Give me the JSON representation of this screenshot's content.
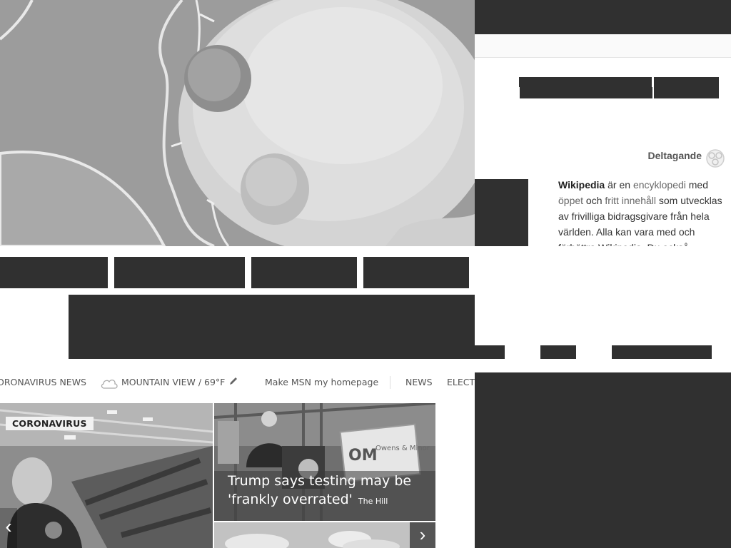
{
  "wiki": {
    "participation_label": "Deltagande",
    "intro": {
      "bold": "Wikipedia",
      "t1": " är en ",
      "link1": "encyklopedi",
      "t2": " med ",
      "link2": "öppet",
      "t3": " och ",
      "link3": "fritt innehåll",
      "t4": " som utvecklas av frivilliga bidragsgivare från hela världen. Alla kan vara med och förbättra Wikipedia. Du också."
    }
  },
  "msn": {
    "coronavirus_news": "ORONAVIRUS NEWS",
    "weather": "MOUNTAIN VIEW / 69°F",
    "homepage_link": "Make MSN my homepage",
    "news_link": "NEWS",
    "elections_link": "ELECTI"
  },
  "cards": {
    "badge": "CORONAVIRUS",
    "headline": "Trump says testing may be 'frankly overrated'",
    "source": "The Hill",
    "sign_text": "Owens & Minor",
    "sign_logo": "OM"
  },
  "icons": {
    "weather": "cloud-icon",
    "edit": "pencil-icon",
    "prev": "chevron-left-icon",
    "next": "chevron-right-icon",
    "participation": "puzzle-globe-icon"
  }
}
